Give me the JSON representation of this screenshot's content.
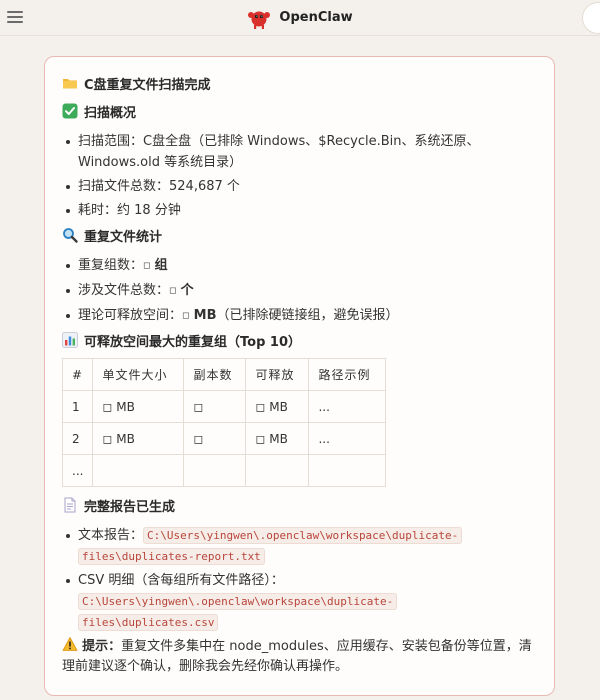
{
  "app": {
    "title": "OpenClaw"
  },
  "icons": {
    "menu": "hamburger-menu-icon",
    "logo": "red-crab-logo-icon"
  },
  "colors": {
    "accent_border": "#e8b9b2",
    "code_text": "#b8453a"
  },
  "card": {
    "title": "C盘重复文件扫描完成",
    "overview": {
      "heading": "扫描概况",
      "items": [
        {
          "label": "扫描范围：",
          "value": "C盘全盘（已排除 Windows、$Recycle.Bin、系统还原、Windows.old 等系统目录）"
        },
        {
          "label": "扫描文件总数：",
          "value": "524,687 个"
        },
        {
          "label": "耗时：",
          "value": "约 18 分钟"
        }
      ]
    },
    "stats": {
      "heading": "重复文件统计",
      "items": [
        {
          "label": "重复组数：",
          "box": "◻",
          "bold": "组",
          "rest": ""
        },
        {
          "label": "涉及文件总数：",
          "box": "◻",
          "bold": "个",
          "rest": ""
        },
        {
          "label": "理论可释放空间：",
          "box": "◻",
          "bold": "MB",
          "rest": "（已排除硬链接组，避免误报）"
        }
      ]
    },
    "top": {
      "heading": "可释放空间最大的重复组（Top 10）",
      "columns": [
        "#",
        "单文件大小",
        "副本数",
        "可释放",
        "路径示例"
      ],
      "rows": [
        [
          "1",
          "◻ MB",
          "◻",
          "◻ MB",
          "..."
        ],
        [
          "2",
          "◻ MB",
          "◻",
          "◻ MB",
          "..."
        ],
        [
          "...",
          "",
          "",
          "",
          ""
        ]
      ]
    },
    "report": {
      "heading": "完整报告已生成",
      "text_label": "文本报告：",
      "text_path_1": "C:\\Users\\yingwen\\.openclaw\\workspace\\duplicate-",
      "text_path_2": "files\\duplicates-report.txt",
      "csv_label": "CSV 明细（含每组所有文件路径）：",
      "csv_path_1": "C:\\Users\\yingwen\\.openclaw\\workspace\\duplicate-",
      "csv_path_2": "files\\duplicates.csv"
    },
    "tip": {
      "label": "提示：",
      "text": "重复文件多集中在 node_modules、应用缓存、安装包备份等位置，清理前建议逐个确认，删除我会先经你确认再操作。"
    }
  }
}
